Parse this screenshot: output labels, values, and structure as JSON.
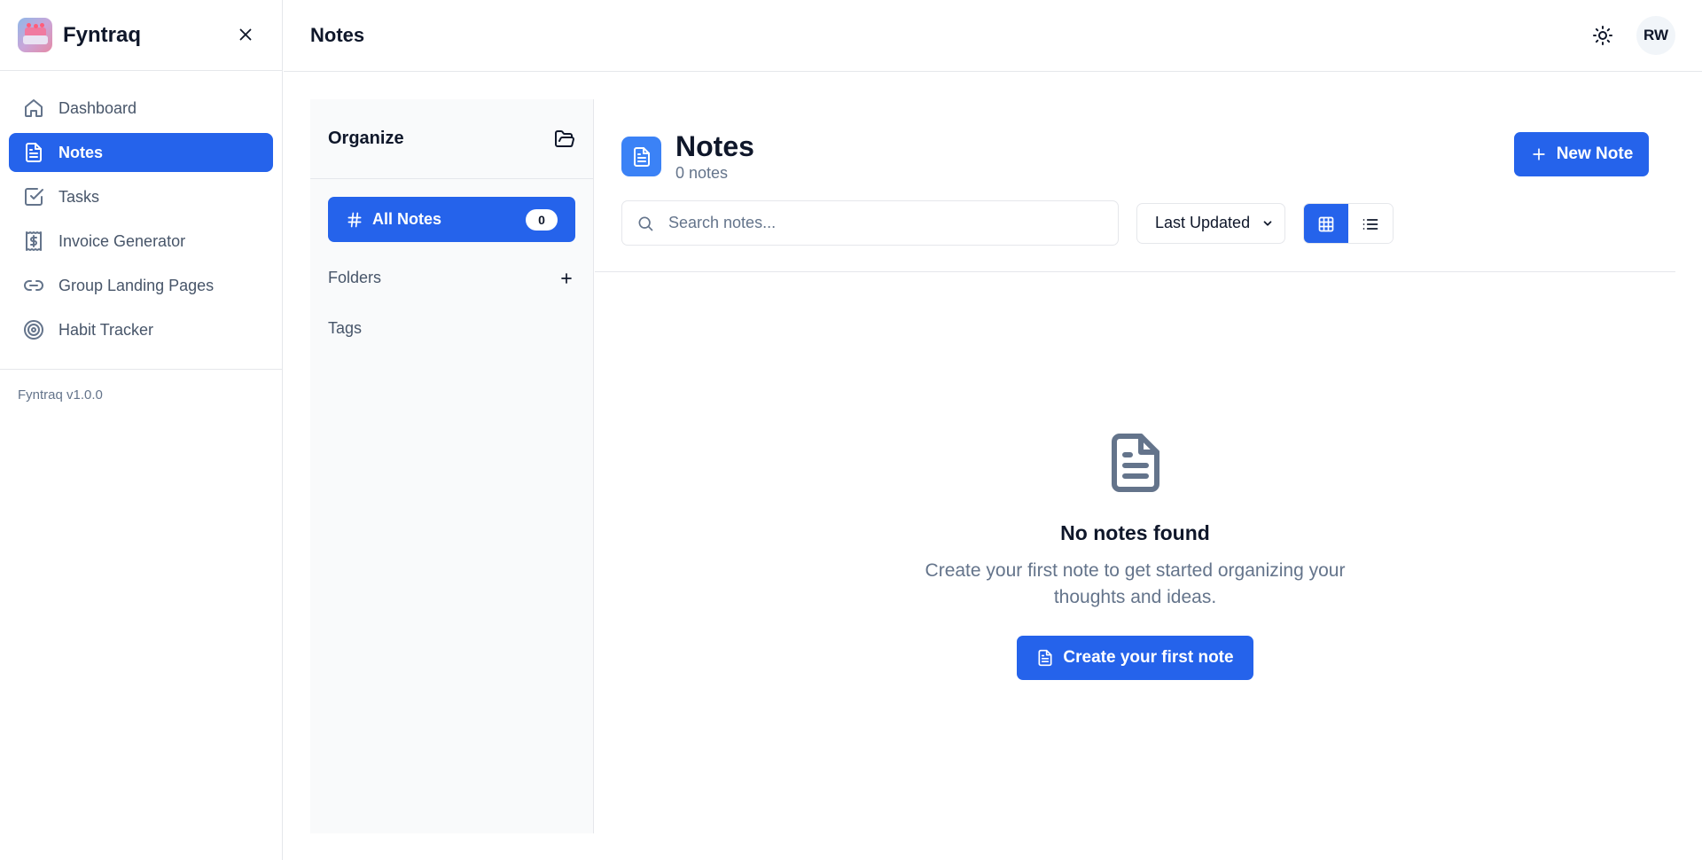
{
  "sidebar": {
    "brand": "Fyntraq",
    "items": [
      {
        "label": "Dashboard",
        "icon": "home-icon"
      },
      {
        "label": "Notes",
        "icon": "file-text-icon",
        "active": true
      },
      {
        "label": "Tasks",
        "icon": "check-square-icon"
      },
      {
        "label": "Invoice Generator",
        "icon": "receipt-dollar-icon"
      },
      {
        "label": "Group Landing Pages",
        "icon": "link-icon"
      },
      {
        "label": "Habit Tracker",
        "icon": "target-icon"
      }
    ],
    "version": "Fyntraq v1.0.0"
  },
  "topbar": {
    "title": "Notes",
    "avatar_initials": "RW"
  },
  "organize": {
    "title": "Organize",
    "all_notes_label": "All Notes",
    "all_notes_count": "0",
    "folders_label": "Folders",
    "tags_label": "Tags"
  },
  "main": {
    "title": "Notes",
    "subtitle": "0 notes",
    "new_note_label": "New Note",
    "search_placeholder": "Search notes...",
    "sort_selected": "Last Updated",
    "view_mode": "grid"
  },
  "empty_state": {
    "title": "No notes found",
    "description": "Create your first note to get started organizing your thoughts and ideas.",
    "button_label": "Create your first note"
  },
  "colors": {
    "accent": "#2563eb",
    "muted_text": "#64748b",
    "border": "#e5e7eb",
    "panel_bg": "#f9fafb"
  }
}
